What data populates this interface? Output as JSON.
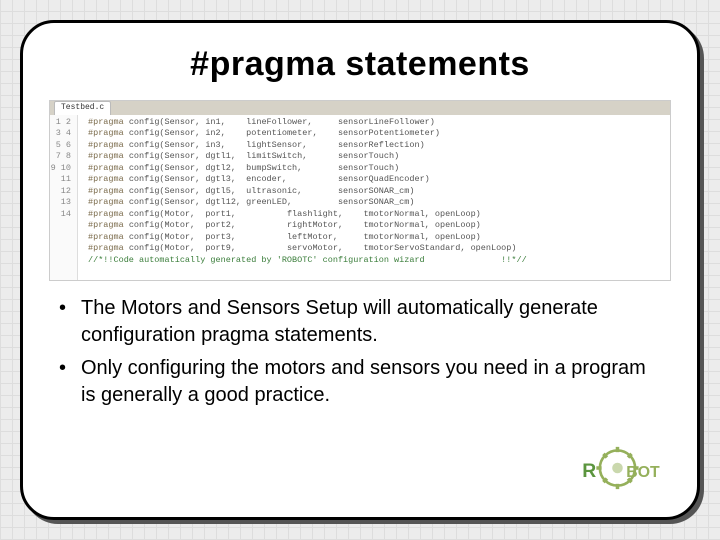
{
  "title": "#pragma statements",
  "editor": {
    "tab": "Testbed.c",
    "lines": [
      "#pragma config(Sensor, in1,    lineFollower,     sensorLineFollower)",
      "#pragma config(Sensor, in2,    potentiometer,    sensorPotentiometer)",
      "#pragma config(Sensor, in3,    lightSensor,      sensorReflection)",
      "#pragma config(Sensor, dgtl1,  limitSwitch,      sensorTouch)",
      "#pragma config(Sensor, dgtl2,  bumpSwitch,       sensorTouch)",
      "#pragma config(Sensor, dgtl3,  encoder,          sensorQuadEncoder)",
      "#pragma config(Sensor, dgtl5,  ultrasonic,       sensorSONAR_cm)",
      "#pragma config(Sensor, dgtl12, greenLED,         sensorSONAR_cm)",
      "#pragma config(Motor,  port1,          flashlight,    tmotorNormal, openLoop)",
      "#pragma config(Motor,  port2,          rightMotor,    tmotorNormal, openLoop)",
      "#pragma config(Motor,  port3,          leftMotor,     tmotorNormal, openLoop)",
      "#pragma config(Motor,  port9,          servoMotor,    tmotorServoStandard, openLoop)",
      "//*!!Code automatically generated by 'ROBOTC' configuration wizard               !!*//",
      ""
    ]
  },
  "bullets": [
    "The Motors and Sensors Setup will automatically generate configuration pragma statements.",
    "Only configuring the motors and sensors you need in a program is generally a good practice."
  ],
  "logo": {
    "r": "R",
    "bot": "BOT",
    "name": "ROBOTC"
  }
}
